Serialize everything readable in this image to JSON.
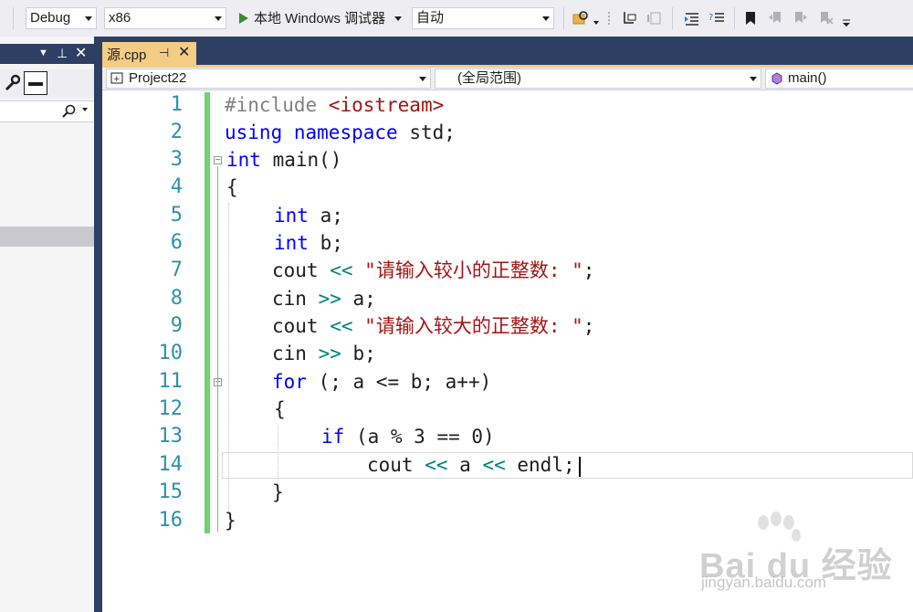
{
  "toolbar": {
    "config": "Debug",
    "platform": "x86",
    "run_label": "本地 Windows 调试器",
    "solution_config": "自动"
  },
  "tab": {
    "filename": "源.cpp",
    "pin_glyph": "⊣",
    "close_glyph": "✕"
  },
  "nav": {
    "project": "Project22",
    "scope": "(全局范围)",
    "member": "main()"
  },
  "colors": {
    "keyword": "#0000ff",
    "string": "#a31515",
    "preprocessor": "#808080",
    "operator": "#008080",
    "line_number": "#2b91af",
    "change_bar": "#6bd66b",
    "tab_active": "#f5cc84",
    "chrome_dark": "#2d3f63"
  },
  "editor": {
    "current_line": 14,
    "lines": [
      "1",
      "2",
      "3",
      "4",
      "5",
      "6",
      "7",
      "8",
      "9",
      "10",
      "11",
      "12",
      "13",
      "14",
      "15",
      "16"
    ]
  },
  "code": {
    "l1": [
      "#include ",
      "<iostream>"
    ],
    "l2": [
      "using",
      " ",
      "namespace",
      " std;"
    ],
    "l3": [
      "int",
      " main()"
    ],
    "l4": "{",
    "l5": [
      "int",
      " a;"
    ],
    "l6": [
      "int",
      " b;"
    ],
    "l7": [
      "cout ",
      "<<",
      " ",
      "\"请输入较小的正整数: \"",
      ";"
    ],
    "l8": [
      "cin ",
      ">>",
      " a;"
    ],
    "l9": [
      "cout ",
      "<<",
      " ",
      "\"请输入较大的正整数: \"",
      ";"
    ],
    "l10": [
      "cin ",
      ">>",
      " b;"
    ],
    "l11": [
      "for",
      " (; a <= b; a++)"
    ],
    "l12": "{",
    "l13": [
      "if",
      " (a % 3 == 0)"
    ],
    "l14": [
      "cout ",
      "<<",
      " a ",
      "<<",
      " endl;"
    ],
    "l15": "}",
    "l16": "}"
  },
  "watermark": {
    "brand": "Bai du 经验",
    "url": "jingyan.baidu.com"
  }
}
